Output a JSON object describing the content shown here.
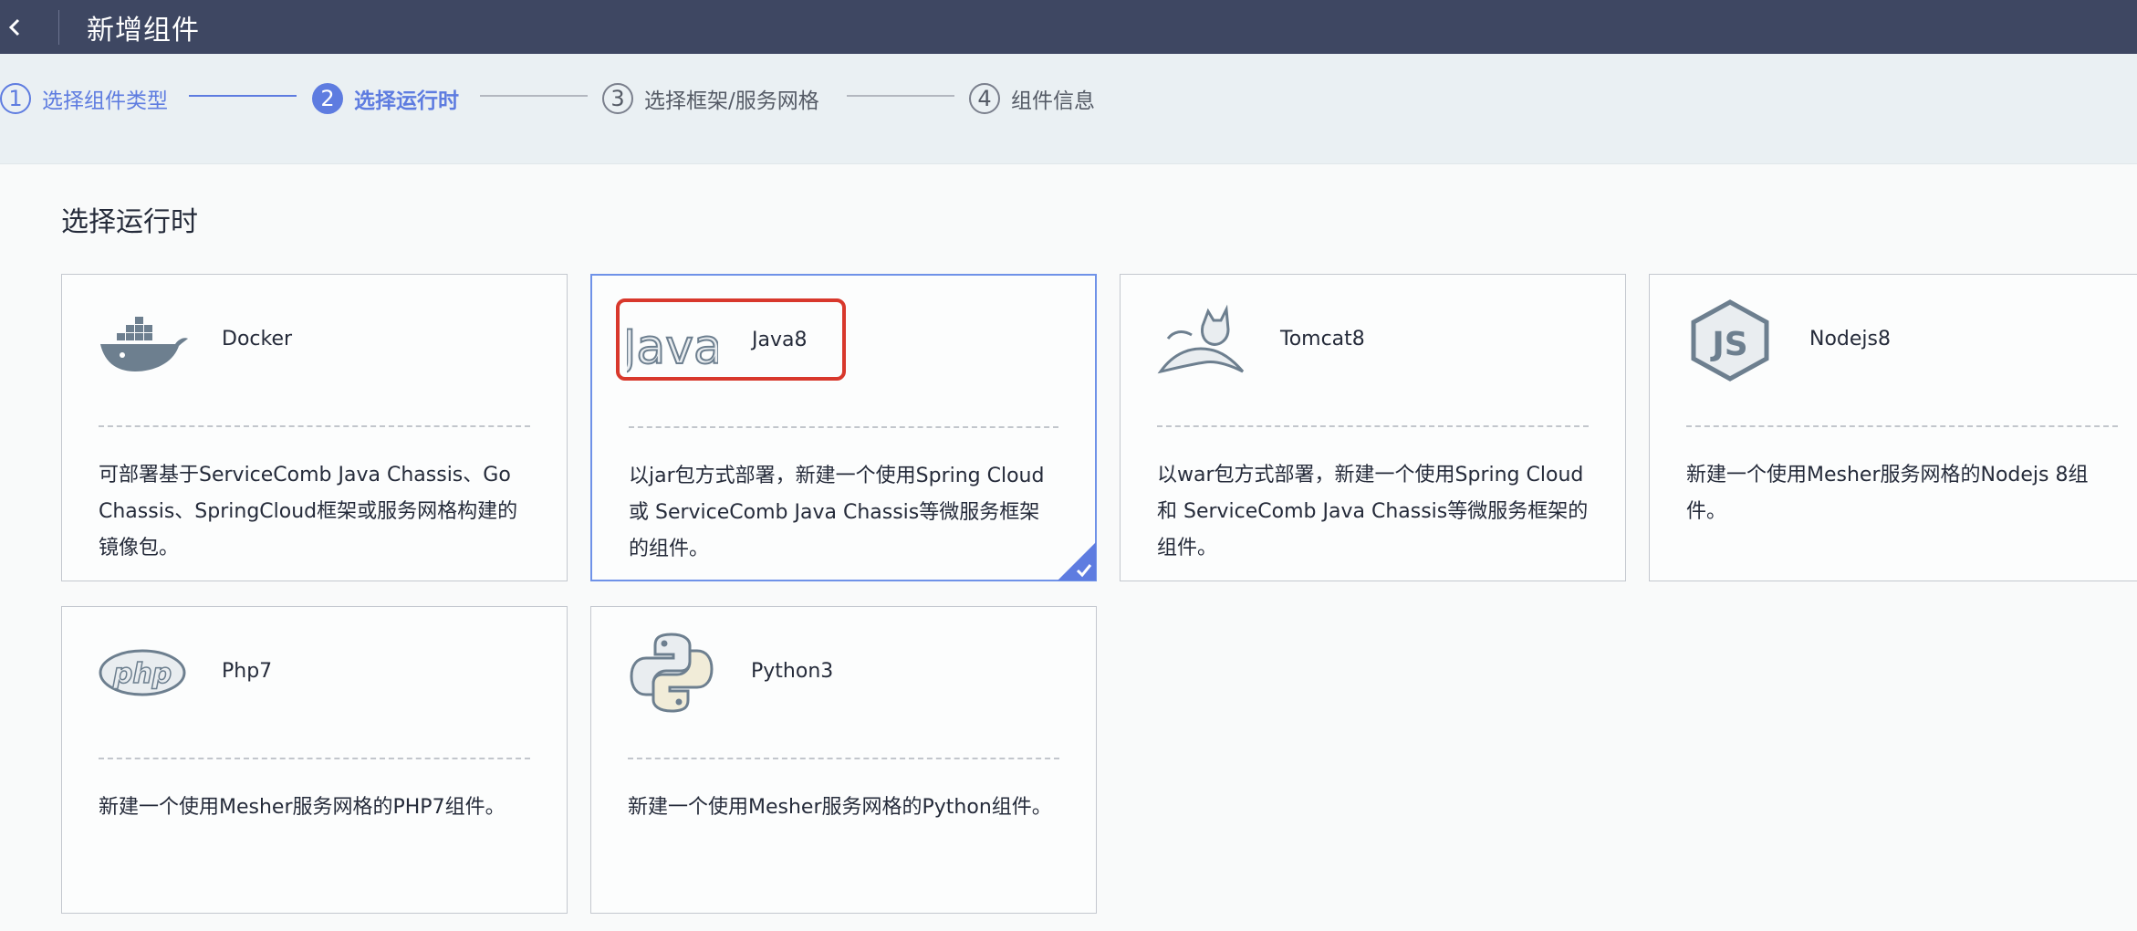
{
  "header": {
    "title": "新增组件"
  },
  "steps": [
    {
      "num": "1",
      "label": "选择组件类型",
      "state": "done"
    },
    {
      "num": "2",
      "label": "选择运行时",
      "state": "active"
    },
    {
      "num": "3",
      "label": "选择框架/服务网格",
      "state": "todo"
    },
    {
      "num": "4",
      "label": "组件信息",
      "state": "todo"
    }
  ],
  "section": {
    "title": "选择运行时"
  },
  "runtimes": [
    {
      "name": "Docker",
      "desc": "可部署基于ServiceComb Java Chassis、Go Chassis、SpringCloud框架或服务网格构建的镜像包。",
      "icon": "docker-icon"
    },
    {
      "name": "Java8",
      "desc": "以jar包方式部署，新建一个使用Spring Cloud 或 ServiceComb Java Chassis等微服务框架的组件。",
      "icon": "java-icon",
      "selected": true
    },
    {
      "name": "Tomcat8",
      "desc": "以war包方式部署，新建一个使用Spring Cloud 和 ServiceComb Java Chassis等微服务框架的组件。",
      "icon": "tomcat-icon"
    },
    {
      "name": "Nodejs8",
      "desc": "新建一个使用Mesher服务网格的Nodejs 8组件。",
      "icon": "nodejs-icon"
    },
    {
      "name": "Php7",
      "desc": "新建一个使用Mesher服务网格的PHP7组件。",
      "icon": "php-icon"
    },
    {
      "name": "Python3",
      "desc": "新建一个使用Mesher服务网格的Python组件。",
      "icon": "python-icon"
    }
  ],
  "logos": {
    "java_text": "Java",
    "php_text": "php",
    "nodejs_text": "JS"
  },
  "colors": {
    "topbar": "#3e4762",
    "accent": "#5e7ce0",
    "highlight": "#d8382c",
    "icon_gray": "#6d7f8f"
  }
}
